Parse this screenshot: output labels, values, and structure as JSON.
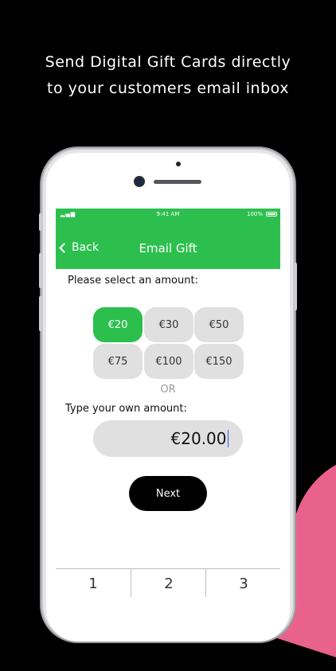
{
  "promo": {
    "line1": "Send Digital Gift Cards directly",
    "line2": "to your customers email inbox"
  },
  "status_bar": {
    "time": "9:41 AM",
    "battery": "100%"
  },
  "nav": {
    "back_label": "Back",
    "title": "Email Gift"
  },
  "form": {
    "prompt": "Please select an amount:",
    "amounts": [
      "€20",
      "€30",
      "€50",
      "€75",
      "€100",
      "€150"
    ],
    "selected_amount": "€20",
    "or_label": "OR",
    "own_amount_label": "Type your own amount:",
    "own_amount_value": "€20.00",
    "next_label": "Next"
  },
  "keypad": {
    "keys": [
      "1",
      "2",
      "3"
    ]
  },
  "colors": {
    "accent": "#2dbf4e",
    "pink": "#e8628b",
    "background": "#000000"
  }
}
